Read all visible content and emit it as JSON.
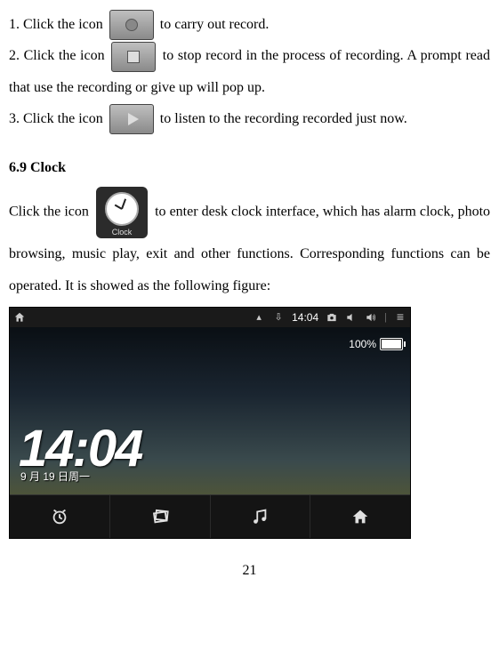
{
  "steps": {
    "s1a": "1. Click the icon ",
    "s1b": " to carry out record.",
    "s2a": "2. Click the icon ",
    "s2b": " to stop record in the process of recording. A prompt read that use the recording or give up will pop up.",
    "s3a": "3. Click the icon ",
    "s3b": " to listen to the recording recorded just now."
  },
  "section_heading": "6.9 Clock",
  "clock_para_a": "Click the icon ",
  "clock_para_b": " to enter desk clock interface, which has alarm clock, photo browsing, music play, exit and other functions. Corresponding functions can be operated. It is showed as the following figure:",
  "clock_icon_label": "Clock",
  "screenshot": {
    "status_time": "14:04",
    "battery_pct": "100%",
    "big_time": "14:04",
    "date_text": "9 月 19 日周一",
    "toolbar_icons": [
      "alarm",
      "gallery",
      "music",
      "home"
    ]
  },
  "page_number": "21"
}
